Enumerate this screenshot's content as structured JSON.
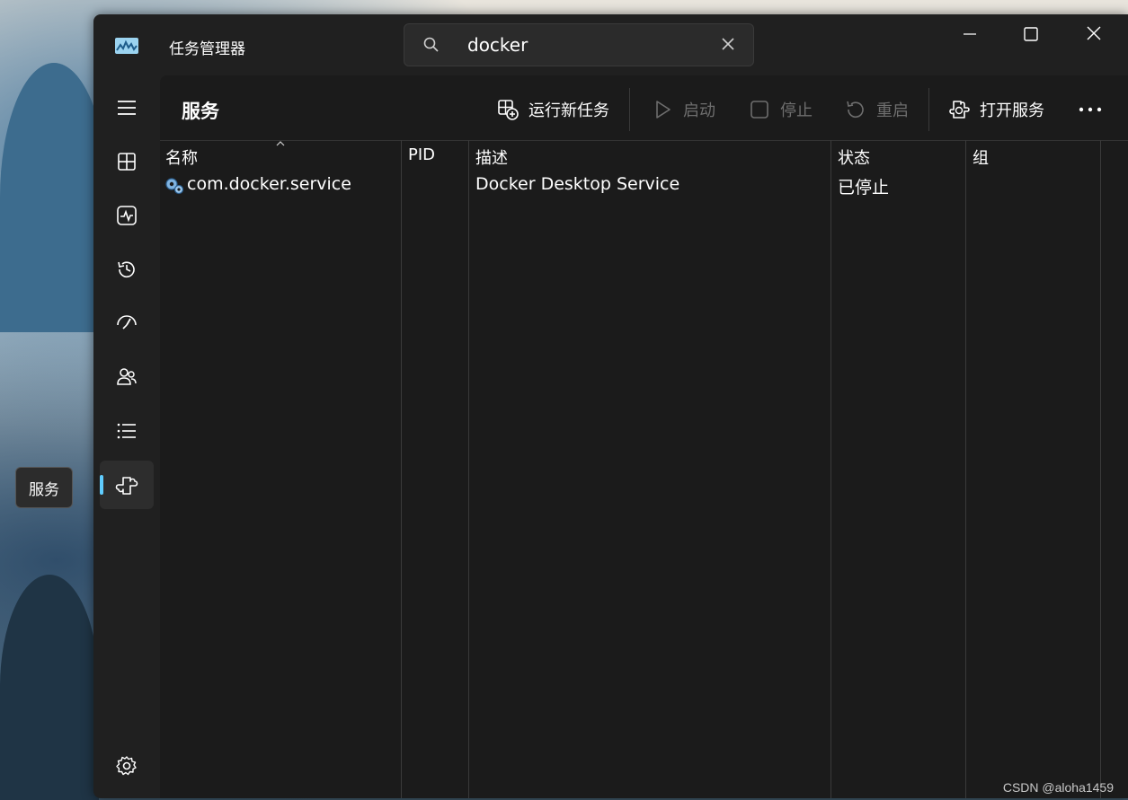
{
  "app": {
    "title": "任务管理器"
  },
  "search": {
    "value": "docker"
  },
  "page": {
    "title": "服务"
  },
  "toolbar": {
    "run_new_task": "运行新任务",
    "start": "启动",
    "stop": "停止",
    "restart": "重启",
    "open_services": "打开服务"
  },
  "sidebar": {
    "items": [
      {
        "icon": "hamburger-menu-icon"
      },
      {
        "icon": "processes-icon"
      },
      {
        "icon": "performance-icon"
      },
      {
        "icon": "app-history-icon"
      },
      {
        "icon": "startup-apps-icon"
      },
      {
        "icon": "users-icon"
      },
      {
        "icon": "details-icon"
      },
      {
        "icon": "services-icon",
        "active": true
      }
    ],
    "tooltip": "服务"
  },
  "table": {
    "columns": [
      "名称",
      "PID",
      "描述",
      "状态",
      "组"
    ],
    "rows": [
      {
        "name": "com.docker.service",
        "pid": "",
        "description": "Docker Desktop Service",
        "status": "已停止",
        "group": ""
      }
    ]
  },
  "colors": {
    "accent": "#60cdff",
    "window_bg": "#202020",
    "content_bg": "#1b1b1b"
  },
  "watermark": "CSDN @aloha1459"
}
